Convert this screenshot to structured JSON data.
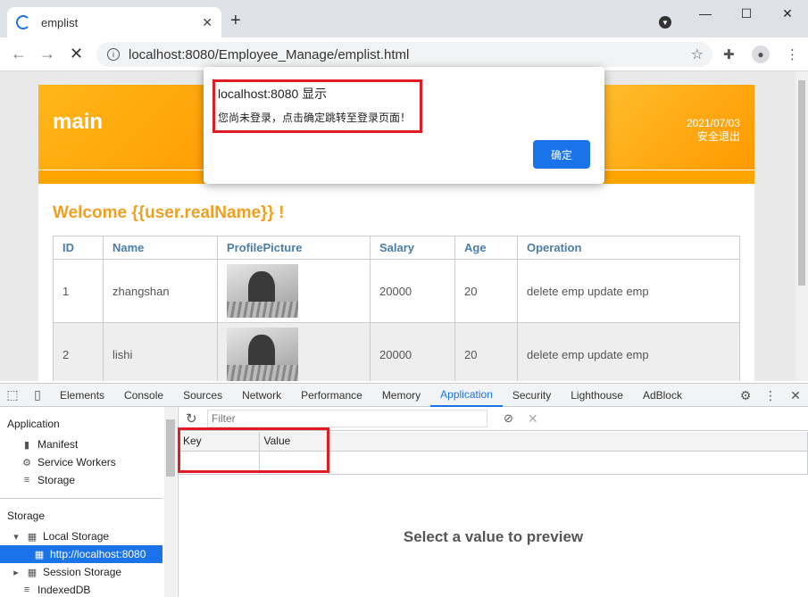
{
  "browser": {
    "tab_title": "emplist",
    "url": "localhost:8080/Employee_Manage/emplist.html"
  },
  "page": {
    "brand": "main",
    "date": "2021/07/03",
    "logout": "安全退出",
    "welcome": "Welcome {{user.realName}} !",
    "table": {
      "headers": [
        "ID",
        "Name",
        "ProfilePicture",
        "Salary",
        "Age",
        "Operation"
      ],
      "rows": [
        {
          "id": "1",
          "name": "zhangshan",
          "salary": "20000",
          "age": "20",
          "delete": "delete emp",
          "update": "update emp"
        },
        {
          "id": "2",
          "name": "lishi",
          "salary": "20000",
          "age": "20",
          "delete": "delete emp",
          "update": "update emp"
        }
      ]
    }
  },
  "alert": {
    "title": "localhost:8080 显示",
    "message": "您尚未登录，点击确定跳转至登录页面！",
    "ok_label": "确定"
  },
  "devtools": {
    "tabs": [
      "Elements",
      "Console",
      "Sources",
      "Network",
      "Performance",
      "Memory",
      "Application",
      "Security",
      "Lighthouse",
      "AdBlock"
    ],
    "active_tab": "Application",
    "sidebar": {
      "section_application": "Application",
      "manifest": "Manifest",
      "service_workers": "Service Workers",
      "storage_item": "Storage",
      "section_storage": "Storage",
      "local_storage": "Local Storage",
      "local_origin": "http://localhost:8080",
      "session_storage": "Session Storage",
      "indexeddb": "IndexedDB"
    },
    "filter_placeholder": "Filter",
    "columns": {
      "key": "Key",
      "value": "Value"
    },
    "preview_text": "Select a value to preview"
  },
  "colors": {
    "accent": "#1a73e8",
    "banner": "#ff9900",
    "highlight_box": "#e01b24"
  }
}
